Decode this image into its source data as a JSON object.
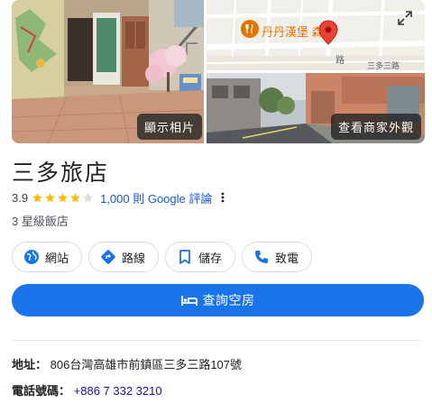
{
  "photos": {
    "show_photos_label": "顯示相片",
    "exterior_label": "查看商家外觀",
    "map_place_label": "丹丹漢堡 森店",
    "map_street_label": "三多三路",
    "map_street_vertical": "路"
  },
  "place": {
    "title": "三多旅店",
    "rating": "3.9",
    "stars_filled": 4,
    "stars_total": 5,
    "reviews": "1,000 則 Google 評論",
    "category": "3 星級飯店"
  },
  "actions": {
    "website": "網站",
    "directions": "路線",
    "save": "儲存",
    "call": "致電"
  },
  "primary": {
    "check_rooms": "查詢空房"
  },
  "details": {
    "address_label": "地址：",
    "address_value": "806台灣高雄市前鎮區三多三路107號",
    "phone_label": "電話號碼：",
    "phone_value": "+886 7 332 3210"
  },
  "colors": {
    "accent": "#1a73e8",
    "star": "#fbbc04",
    "map_pin": "#ea4335",
    "map_poi": "#e37400"
  }
}
